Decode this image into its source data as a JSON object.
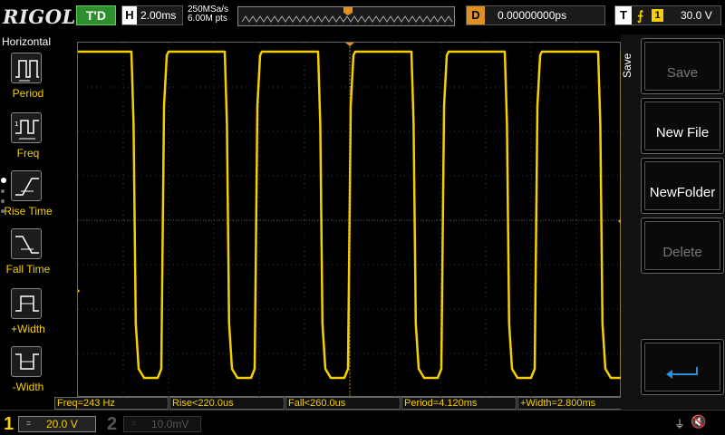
{
  "topbar": {
    "logo": "RIGOL",
    "run_state": "T'D",
    "horizontal": {
      "label": "H",
      "value": "2.00ms"
    },
    "sample_rate": "250MSa/s",
    "memory_depth": "6.00M pts",
    "trigger_pos_marker": "T",
    "delay": {
      "label": "D",
      "value": "0.00000000ps"
    },
    "trigger": {
      "label": "T",
      "edge": "rising",
      "source": "1",
      "level": "30.0 V"
    }
  },
  "left_menu": {
    "title": "Horizontal",
    "items": [
      {
        "label": "Period",
        "icon": "period-icon"
      },
      {
        "label": "Freq",
        "icon": "frequency-icon"
      },
      {
        "label": "Rise Time",
        "icon": "rise-time-icon"
      },
      {
        "label": "Fall Time",
        "icon": "fall-time-icon"
      },
      {
        "label": "+Width",
        "icon": "positive-width-icon"
      },
      {
        "label": "-Width",
        "icon": "negative-width-icon"
      }
    ]
  },
  "right_menu": {
    "title": "Save",
    "buttons": [
      {
        "label": "Save",
        "enabled": false
      },
      {
        "label": "New File",
        "enabled": true
      },
      {
        "label": "NewFolder",
        "enabled": true
      },
      {
        "label": "Delete",
        "enabled": false
      },
      {
        "label": "",
        "icon": "return-arrow-icon",
        "enabled": true
      }
    ]
  },
  "grid_markers": {
    "channel1_ground": "1",
    "trigger_level": "T",
    "trigger_position": "T"
  },
  "measurements": [
    {
      "text": "Freq=243 Hz"
    },
    {
      "text": "Rise<220.0us"
    },
    {
      "text": "Fall<260.0us"
    },
    {
      "text": "Period=4.120ms"
    },
    {
      "text": "+Width=2.800ms"
    }
  ],
  "bottombar": {
    "ch1": {
      "number": "1",
      "coupling": "=",
      "scale": "20.0 V"
    },
    "ch2": {
      "number": "2",
      "coupling": "=",
      "scale": "10.0mV"
    },
    "status_icons": [
      "usb-icon",
      "speaker-muted-icon"
    ]
  },
  "waveform": {
    "color": "#f5d000",
    "type": "square",
    "period_ms": 4.12,
    "positive_width_ms": 2.8,
    "frequency_hz": 243
  },
  "colors": {
    "channel1": "#f5d000",
    "trigger": "#e09020",
    "run_state": "#2f8f2f"
  }
}
